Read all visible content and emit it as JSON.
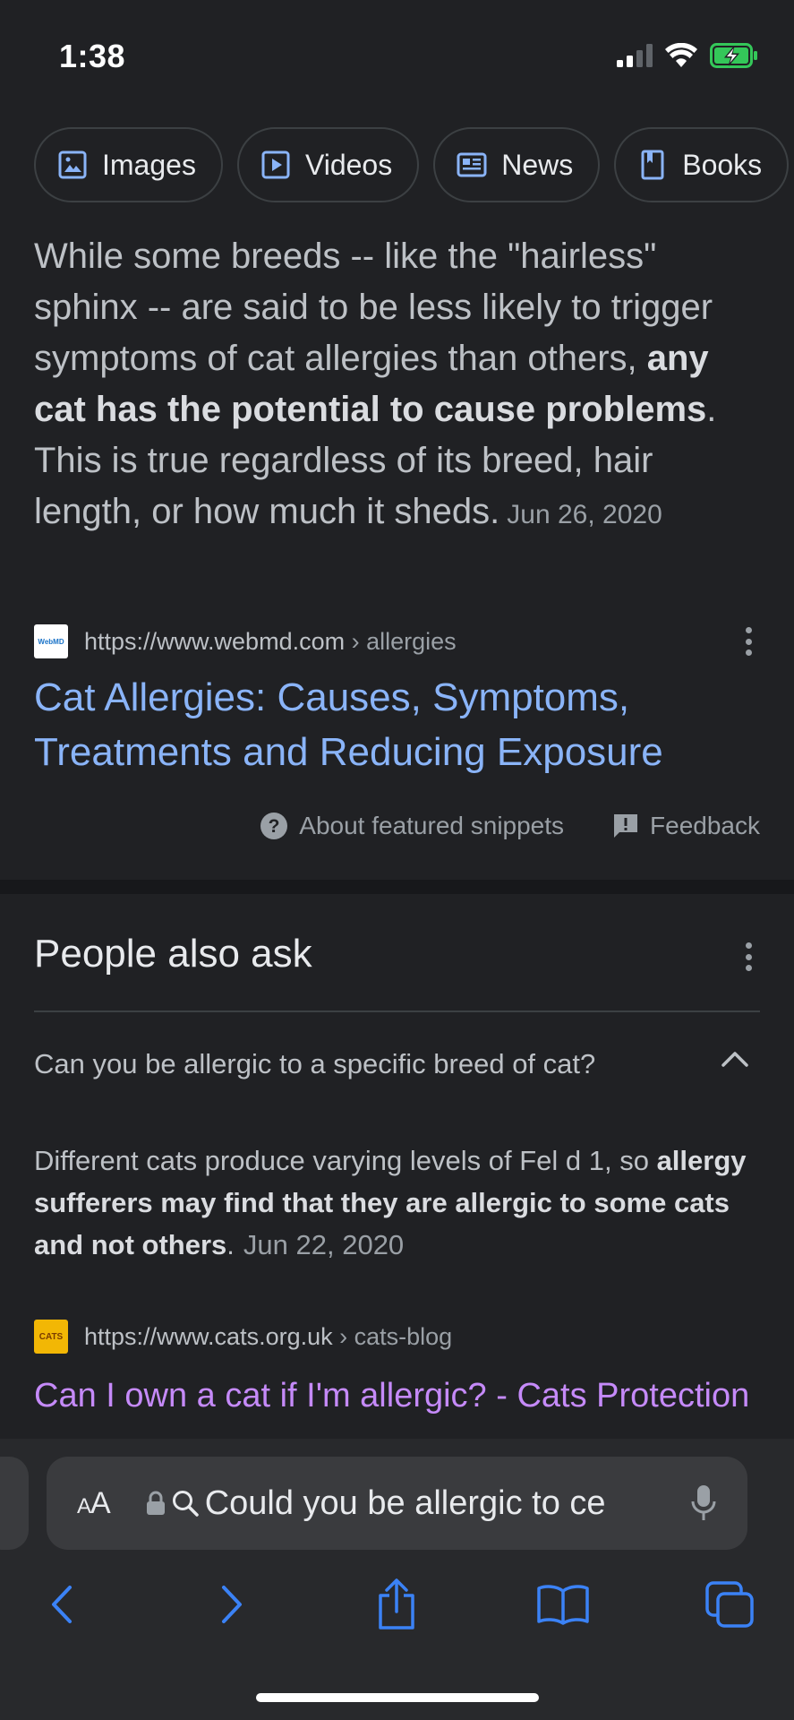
{
  "status": {
    "time": "1:38"
  },
  "chips": [
    {
      "label": "Images",
      "icon": "image-icon"
    },
    {
      "label": "Videos",
      "icon": "play-icon"
    },
    {
      "label": "News",
      "icon": "news-icon"
    },
    {
      "label": "Books",
      "icon": "book-icon"
    }
  ],
  "snippet": {
    "text_before": "While some breeds -- like the \"hairless\" sphinx -- are said to be less likely to trigger symptoms of cat allergies than others, ",
    "bold": "any cat has the potential to cause problems",
    "text_after": ". This is true regardless of its breed, hair length, or how much it sheds.",
    "date": "Jun 26, 2020"
  },
  "result1": {
    "favicon_text": "WebMD",
    "url": "https://www.webmd.com",
    "crumb": " › allergies",
    "title": "Cat Allergies: Causes, Symptoms, Treatments and Reducing Exposure"
  },
  "snippet_footer": {
    "about": "About featured snippets",
    "feedback": "Feedback"
  },
  "paa": {
    "title": "People also ask",
    "question": "Can you be allergic to a specific breed of cat?",
    "answer_before": "Different cats produce varying levels of Fel d 1, so ",
    "answer_bold": "allergy sufferers may find that they are allergic to some cats and not others",
    "answer_after": ".",
    "answer_date": "Jun 22, 2020",
    "source_favicon_text": "CATS",
    "source_url": "https://www.cats.org.uk",
    "source_crumb": " › cats-blog",
    "source_title": "Can I own a cat if I'm allergic? - Cats Protection"
  },
  "browser": {
    "aa_label": "AA",
    "address_text": "Could you be allergic to ce"
  },
  "colors": {
    "background": "#202124",
    "link": "#8ab4f8",
    "visited_link": "#c58af9",
    "toolbar_icon": "#3b82f6"
  }
}
